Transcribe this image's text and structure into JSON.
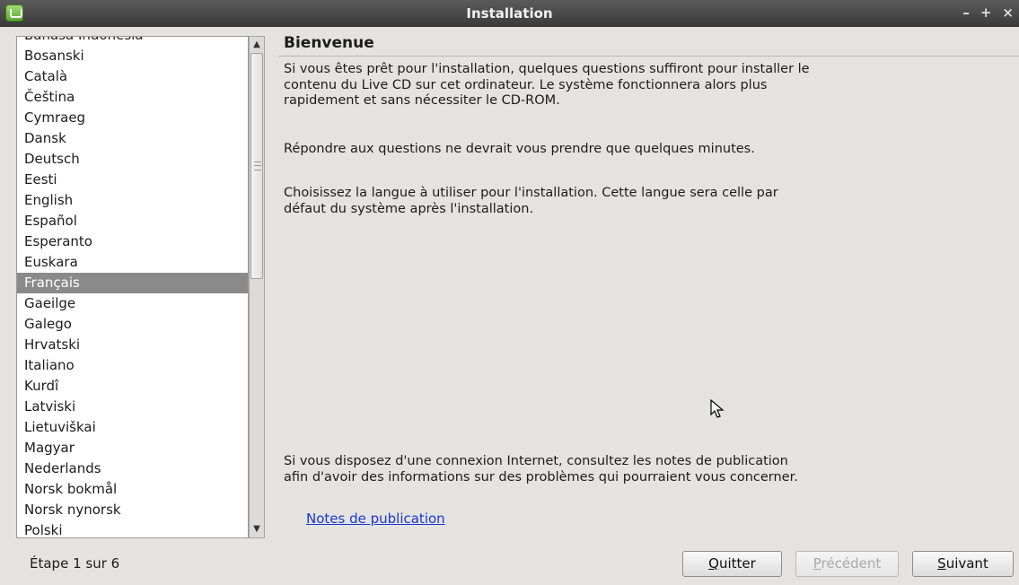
{
  "window": {
    "title": "Installation",
    "controls": [
      "–",
      "+",
      "×"
    ]
  },
  "languages": {
    "items": [
      "Bahasa Indonesia",
      "Bosanski",
      "Català",
      "Čeština",
      "Cymraeg",
      "Dansk",
      "Deutsch",
      "Eesti",
      "English",
      "Español",
      "Esperanto",
      "Euskara",
      "Français",
      "Gaeilge",
      "Galego",
      "Hrvatski",
      "Italiano",
      "Kurdî",
      "Latviski",
      "Lietuviškai",
      "Magyar",
      "Nederlands",
      "Norsk bokmål",
      "Norsk nynorsk",
      "Polski"
    ],
    "selected": "Français"
  },
  "content": {
    "heading": "Bienvenue",
    "paragraph1": "Si vous êtes prêt pour l'installation, quelques questions suffiront pour installer le contenu du Live CD sur cet ordinateur. Le système fonctionnera alors plus rapidement et sans nécessiter le CD-ROM.",
    "paragraph2": "Répondre aux questions ne devrait vous prendre que quelques minutes.",
    "paragraph3": "Choisissez la langue à utiliser pour l'installation. Cette langue sera celle par défaut du système après l'installation.",
    "paragraph4": "Si vous disposez d'une connexion Internet, consultez les notes de publication afin d'avoir des informations sur des problèmes qui pourraient vous concerner.",
    "notes_link": "Notes de publication"
  },
  "footer": {
    "step": "Étape 1 sur 6",
    "quit": {
      "mnemonic": "Q",
      "rest": "uitter"
    },
    "prev": {
      "mnemonic": "P",
      "rest": "récédent"
    },
    "next": {
      "mnemonic": "S",
      "rest": "uivant"
    }
  }
}
